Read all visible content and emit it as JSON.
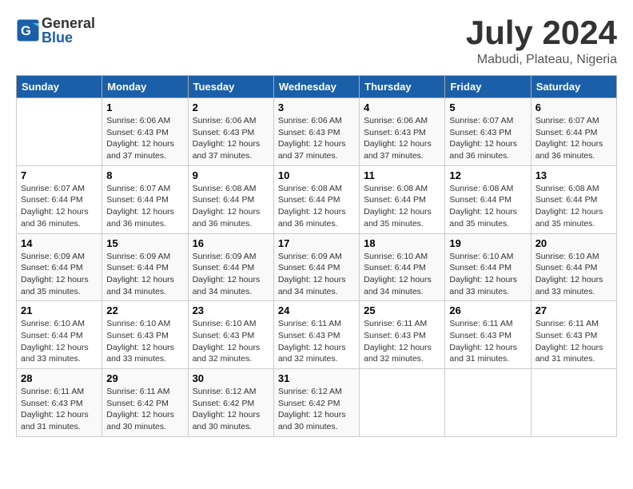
{
  "header": {
    "logo_general": "General",
    "logo_blue": "Blue",
    "month_title": "July 2024",
    "location": "Mabudi, Plateau, Nigeria"
  },
  "weekdays": [
    "Sunday",
    "Monday",
    "Tuesday",
    "Wednesday",
    "Thursday",
    "Friday",
    "Saturday"
  ],
  "weeks": [
    [
      {
        "day": "",
        "info": ""
      },
      {
        "day": "1",
        "info": "Sunrise: 6:06 AM\nSunset: 6:43 PM\nDaylight: 12 hours\nand 37 minutes."
      },
      {
        "day": "2",
        "info": "Sunrise: 6:06 AM\nSunset: 6:43 PM\nDaylight: 12 hours\nand 37 minutes."
      },
      {
        "day": "3",
        "info": "Sunrise: 6:06 AM\nSunset: 6:43 PM\nDaylight: 12 hours\nand 37 minutes."
      },
      {
        "day": "4",
        "info": "Sunrise: 6:06 AM\nSunset: 6:43 PM\nDaylight: 12 hours\nand 37 minutes."
      },
      {
        "day": "5",
        "info": "Sunrise: 6:07 AM\nSunset: 6:43 PM\nDaylight: 12 hours\nand 36 minutes."
      },
      {
        "day": "6",
        "info": "Sunrise: 6:07 AM\nSunset: 6:44 PM\nDaylight: 12 hours\nand 36 minutes."
      }
    ],
    [
      {
        "day": "7",
        "info": "Sunrise: 6:07 AM\nSunset: 6:44 PM\nDaylight: 12 hours\nand 36 minutes."
      },
      {
        "day": "8",
        "info": "Sunrise: 6:07 AM\nSunset: 6:44 PM\nDaylight: 12 hours\nand 36 minutes."
      },
      {
        "day": "9",
        "info": "Sunrise: 6:08 AM\nSunset: 6:44 PM\nDaylight: 12 hours\nand 36 minutes."
      },
      {
        "day": "10",
        "info": "Sunrise: 6:08 AM\nSunset: 6:44 PM\nDaylight: 12 hours\nand 36 minutes."
      },
      {
        "day": "11",
        "info": "Sunrise: 6:08 AM\nSunset: 6:44 PM\nDaylight: 12 hours\nand 35 minutes."
      },
      {
        "day": "12",
        "info": "Sunrise: 6:08 AM\nSunset: 6:44 PM\nDaylight: 12 hours\nand 35 minutes."
      },
      {
        "day": "13",
        "info": "Sunrise: 6:08 AM\nSunset: 6:44 PM\nDaylight: 12 hours\nand 35 minutes."
      }
    ],
    [
      {
        "day": "14",
        "info": "Sunrise: 6:09 AM\nSunset: 6:44 PM\nDaylight: 12 hours\nand 35 minutes."
      },
      {
        "day": "15",
        "info": "Sunrise: 6:09 AM\nSunset: 6:44 PM\nDaylight: 12 hours\nand 34 minutes."
      },
      {
        "day": "16",
        "info": "Sunrise: 6:09 AM\nSunset: 6:44 PM\nDaylight: 12 hours\nand 34 minutes."
      },
      {
        "day": "17",
        "info": "Sunrise: 6:09 AM\nSunset: 6:44 PM\nDaylight: 12 hours\nand 34 minutes."
      },
      {
        "day": "18",
        "info": "Sunrise: 6:10 AM\nSunset: 6:44 PM\nDaylight: 12 hours\nand 34 minutes."
      },
      {
        "day": "19",
        "info": "Sunrise: 6:10 AM\nSunset: 6:44 PM\nDaylight: 12 hours\nand 33 minutes."
      },
      {
        "day": "20",
        "info": "Sunrise: 6:10 AM\nSunset: 6:44 PM\nDaylight: 12 hours\nand 33 minutes."
      }
    ],
    [
      {
        "day": "21",
        "info": "Sunrise: 6:10 AM\nSunset: 6:44 PM\nDaylight: 12 hours\nand 33 minutes."
      },
      {
        "day": "22",
        "info": "Sunrise: 6:10 AM\nSunset: 6:43 PM\nDaylight: 12 hours\nand 33 minutes."
      },
      {
        "day": "23",
        "info": "Sunrise: 6:10 AM\nSunset: 6:43 PM\nDaylight: 12 hours\nand 32 minutes."
      },
      {
        "day": "24",
        "info": "Sunrise: 6:11 AM\nSunset: 6:43 PM\nDaylight: 12 hours\nand 32 minutes."
      },
      {
        "day": "25",
        "info": "Sunrise: 6:11 AM\nSunset: 6:43 PM\nDaylight: 12 hours\nand 32 minutes."
      },
      {
        "day": "26",
        "info": "Sunrise: 6:11 AM\nSunset: 6:43 PM\nDaylight: 12 hours\nand 31 minutes."
      },
      {
        "day": "27",
        "info": "Sunrise: 6:11 AM\nSunset: 6:43 PM\nDaylight: 12 hours\nand 31 minutes."
      }
    ],
    [
      {
        "day": "28",
        "info": "Sunrise: 6:11 AM\nSunset: 6:43 PM\nDaylight: 12 hours\nand 31 minutes."
      },
      {
        "day": "29",
        "info": "Sunrise: 6:11 AM\nSunset: 6:42 PM\nDaylight: 12 hours\nand 30 minutes."
      },
      {
        "day": "30",
        "info": "Sunrise: 6:12 AM\nSunset: 6:42 PM\nDaylight: 12 hours\nand 30 minutes."
      },
      {
        "day": "31",
        "info": "Sunrise: 6:12 AM\nSunset: 6:42 PM\nDaylight: 12 hours\nand 30 minutes."
      },
      {
        "day": "",
        "info": ""
      },
      {
        "day": "",
        "info": ""
      },
      {
        "day": "",
        "info": ""
      }
    ]
  ]
}
